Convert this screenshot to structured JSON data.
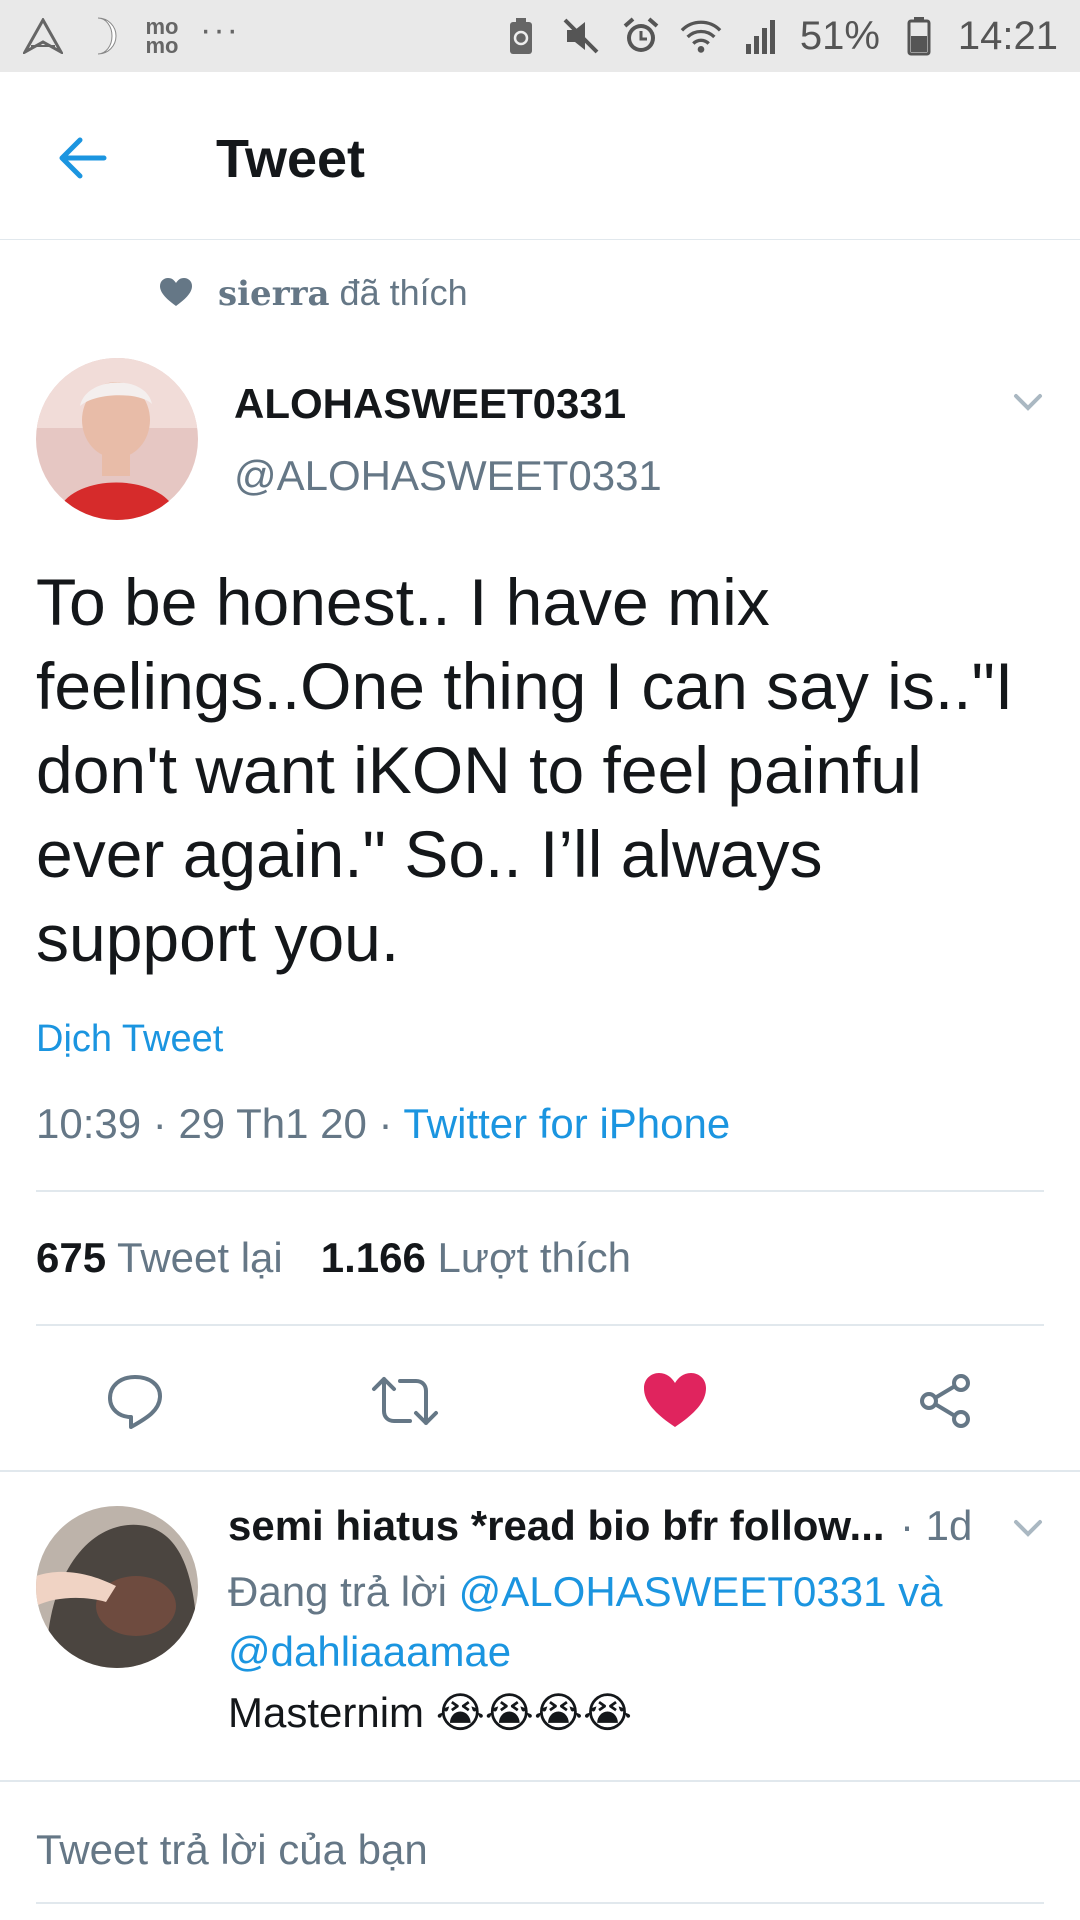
{
  "status_bar": {
    "momo_label": "mo\nmo",
    "overflow": "···",
    "battery_percent": "51%",
    "time": "14:21",
    "icons": [
      "navigation-icon",
      "moon-icon",
      "momo-icon",
      "recycle-battery-icon",
      "mute-icon",
      "alarm-icon",
      "wifi-icon",
      "signal-icon",
      "battery-icon"
    ]
  },
  "app_bar": {
    "title": "Tweet",
    "back_icon": "arrow-left-icon"
  },
  "social_context": {
    "name": "sierra",
    "action": " đã thích",
    "icon": "heart-icon"
  },
  "tweet": {
    "display_name": "ALOHASWEET0331",
    "handle": "@ALOHASWEET0331",
    "text": "To be honest.. I have mix feelings..One thing I can say is..\"I don't want iKON to feel painful ever again.\" So.. I’ll always support you.",
    "translate_label": "Dịch Tweet",
    "time": "10:39",
    "date": "29 Th1 20",
    "separator": " · ",
    "source": "Twitter for iPhone",
    "retweet_count": "675",
    "retweet_label": "Tweet lại",
    "like_count": "1.166",
    "like_label": "Lượt thích",
    "liked": true
  },
  "actions": {
    "reply_icon": "reply-icon",
    "retweet_icon": "retweet-icon",
    "like_icon": "heart-filled-icon",
    "share_icon": "share-icon",
    "like_color": "#e0245e"
  },
  "reply": {
    "display_name": "semi hiatus *read bio bfr follow...",
    "time": "· 1d",
    "replying_prefix": "Đang trả lời ",
    "mention_1": "@ALOHASWEET0331",
    "conjunction": " và ",
    "mention_2": "@dahliaaamae",
    "text": "Masternim",
    "emojis": "😭😭😭😭"
  },
  "compose": {
    "placeholder": "Tweet trả lời của bạn"
  },
  "colors": {
    "accent": "#1b95e0",
    "secondary_text": "#657786",
    "divider": "#e1e8ed"
  }
}
